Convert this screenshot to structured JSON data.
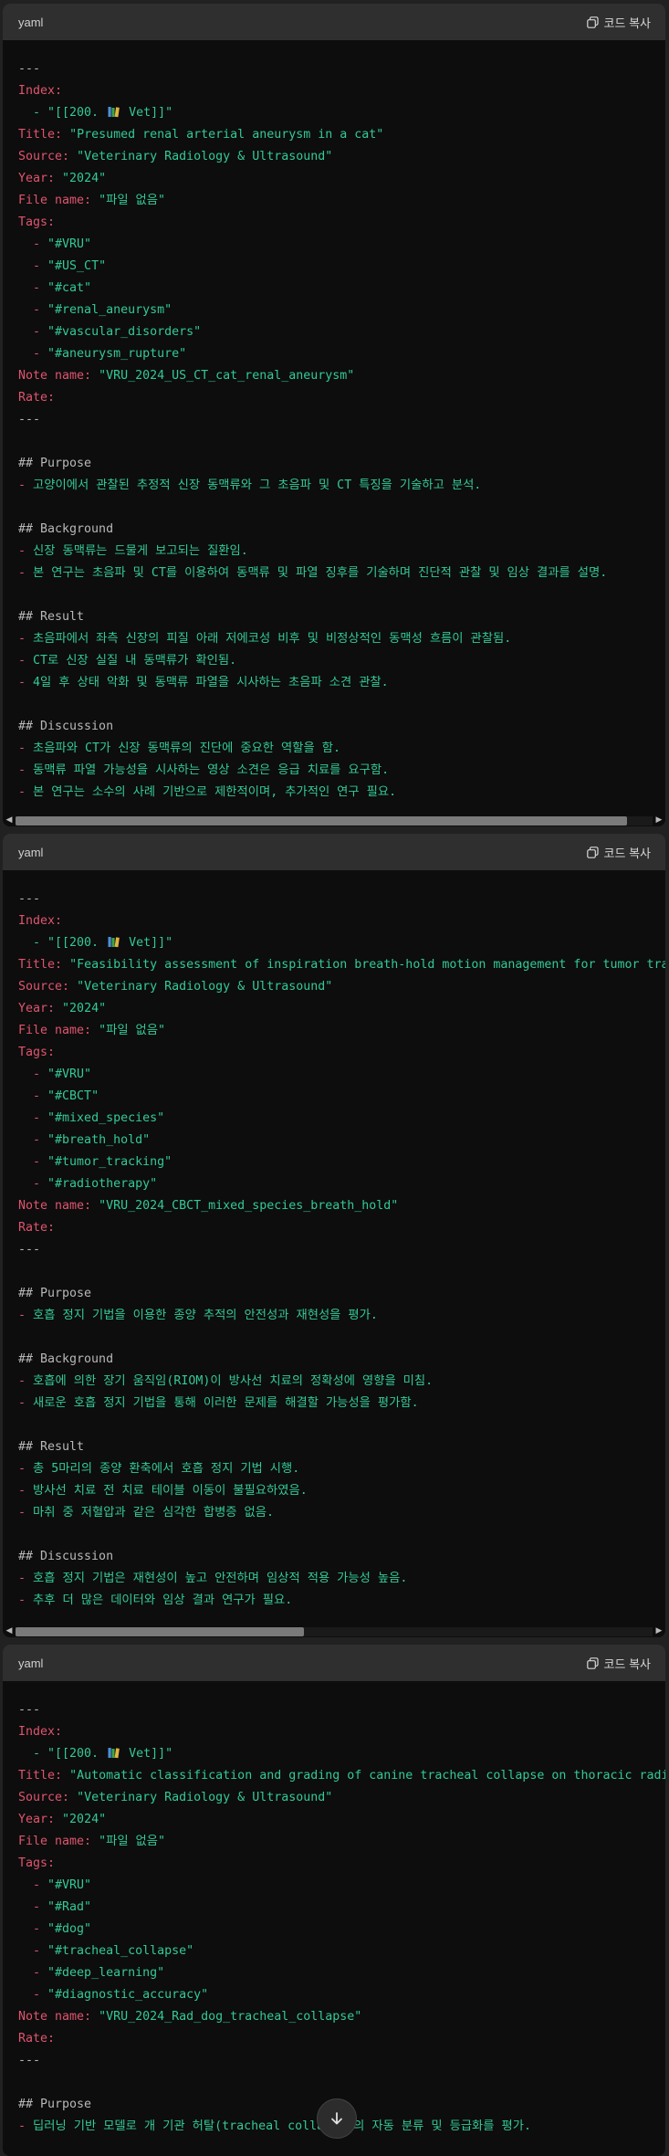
{
  "blocks": [
    {
      "lang": "yaml",
      "copy_label": "코드 복사",
      "index_pre": "  - \"[[200. ",
      "index_post": " Vet]]\"",
      "title": "\"Presumed renal arterial aneurysm in a cat\"",
      "source": "\"Veterinary Radiology & Ultrasound\"",
      "year": "\"2024\"",
      "file_name": "\"파일 없음\"",
      "tags": [
        "\"#VRU\"",
        "\"#US_CT\"",
        "\"#cat\"",
        "\"#renal_aneurysm\"",
        "\"#vascular_disorders\"",
        "\"#aneurysm_rupture\""
      ],
      "note_name": "\"VRU_2024_US_CT_cat_renal_aneurysm\"",
      "sections": [
        {
          "heading": "## Purpose",
          "lines": [
            "- 고양이에서 관찰된 추정적 신장 동맥류와 그 초음파 및 CT 특징을 기술하고 분석."
          ]
        },
        {
          "heading": "## Background",
          "lines": [
            "- 신장 동맥류는 드물게 보고되는 질환임.",
            "- 본 연구는 초음파 및 CT를 이용하여 동맥류 및 파열 징후를 기술하며 진단적 관찰 및 임상 결과를 설명."
          ]
        },
        {
          "heading": "## Result",
          "lines": [
            "- 초음파에서 좌측 신장의 피질 아래 저에코성 비후 및 비정상적인 동맥성 흐름이 관찰됨.",
            "- CT로 신장 실질 내 동맥류가 확인됨.",
            "- 4일 후 상태 악화 및 동맥류 파열을 시사하는 초음파 소견 관찰."
          ]
        },
        {
          "heading": "## Discussion",
          "lines": [
            "- 초음파와 CT가 신장 동맥류의 진단에 중요한 역할을 함.",
            "- 동맥류 파열 가능성을 시사하는 영상 소견은 응급 치료를 요구함.",
            "- 본 연구는 소수의 사례 기반으로 제한적이며, 추가적인 연구 필요."
          ]
        }
      ]
    },
    {
      "lang": "yaml",
      "copy_label": "코드 복사",
      "index_pre": "  - \"[[200. ",
      "index_post": " Vet]]\"",
      "title": "\"Feasibility assessment of inspiration breath-hold motion management for tumor tracking",
      "source": "\"Veterinary Radiology & Ultrasound\"",
      "year": "\"2024\"",
      "file_name": "\"파일 없음\"",
      "tags": [
        "\"#VRU\"",
        "\"#CBCT\"",
        "\"#mixed_species\"",
        "\"#breath_hold\"",
        "\"#tumor_tracking\"",
        "\"#radiotherapy\""
      ],
      "note_name": "\"VRU_2024_CBCT_mixed_species_breath_hold\"",
      "sections": [
        {
          "heading": "## Purpose",
          "lines": [
            "- 호흡 정지 기법을 이용한 종양 추적의 안전성과 재현성을 평가."
          ]
        },
        {
          "heading": "## Background",
          "lines": [
            "- 호흡에 의한 장기 움직임(RIOM)이 방사선 치료의 정확성에 영향을 미침.",
            "- 새로운 호흡 정지 기법을 통해 이러한 문제를 해결할 가능성을 평가함."
          ]
        },
        {
          "heading": "## Result",
          "lines": [
            "- 총 5마리의 종양 환축에서 호흡 정지 기법 시행.",
            "- 방사선 치료 전 치료 테이블 이동이 불필요하였음.",
            "- 마취 중 저혈압과 같은 심각한 합병증 없음."
          ]
        },
        {
          "heading": "## Discussion",
          "lines": [
            "- 호흡 정지 기법은 재현성이 높고 안전하며 임상적 적용 가능성 높음.",
            "- 추후 더 많은 데이터와 임상 결과 연구가 필요."
          ]
        }
      ]
    },
    {
      "lang": "yaml",
      "copy_label": "코드 복사",
      "index_pre": "  - \"[[200. ",
      "index_post": " Vet]]\"",
      "title": "\"Automatic classification and grading of canine tracheal collapse on thoracic radiogra",
      "source": "\"Veterinary Radiology & Ultrasound\"",
      "year": "\"2024\"",
      "file_name": "\"파일 없음\"",
      "tags": [
        "\"#VRU\"",
        "\"#Rad\"",
        "\"#dog\"",
        "\"#tracheal_collapse\"",
        "\"#deep_learning\"",
        "\"#diagnostic_accuracy\""
      ],
      "note_name": "\"VRU_2024_Rad_dog_tracheal_collapse\"",
      "sections": [
        {
          "heading": "## Purpose",
          "lines": [
            "- 딥러닝 기반 모델로 개 기관 허탈(tracheal collapse)의 자동 분류 및 등급화를 평가."
          ]
        }
      ]
    }
  ],
  "keys": {
    "sep": "---",
    "index": "Index:",
    "title": "Title:",
    "source": "Source:",
    "year": "Year:",
    "file_name": "File name:",
    "tags": "Tags:",
    "tag_prefix": "  - ",
    "note_name": "Note name:",
    "rate": "Rate:"
  },
  "colors": {
    "key": "#e0546e",
    "string": "#33c998",
    "text": "#b8b8b8",
    "header_bg": "#2f2f2f",
    "code_bg": "#0d0d0d"
  },
  "icons": {
    "copy": "copy-icon",
    "vet": "books-icon",
    "scroll_down": "arrow-down-icon"
  }
}
